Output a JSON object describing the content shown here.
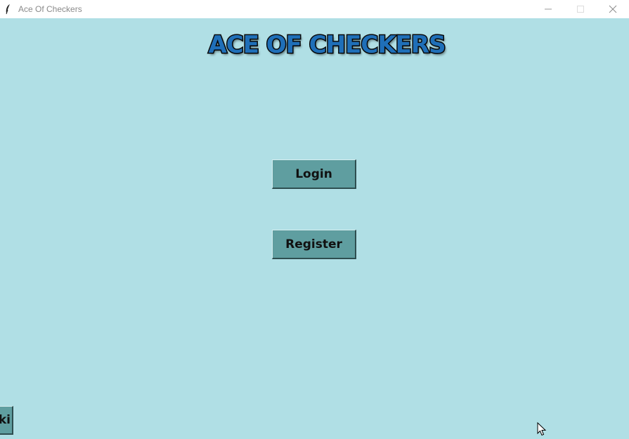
{
  "window": {
    "title": "Ace Of Checkers",
    "icon": "feather-icon",
    "controls": [
      "minimize-icon",
      "maximize-icon",
      "close-icon"
    ]
  },
  "header": {
    "logo_text": "ACE OF CHECKERS"
  },
  "main": {
    "login_label": "Login",
    "register_label": "Register"
  },
  "corner_button": {
    "visible_label": "ki"
  },
  "colors": {
    "background": "#b0dfe5",
    "button": "#5f9ea0",
    "logo_fill": "#1f6fb8",
    "logo_outline": "#0b0b0b"
  }
}
